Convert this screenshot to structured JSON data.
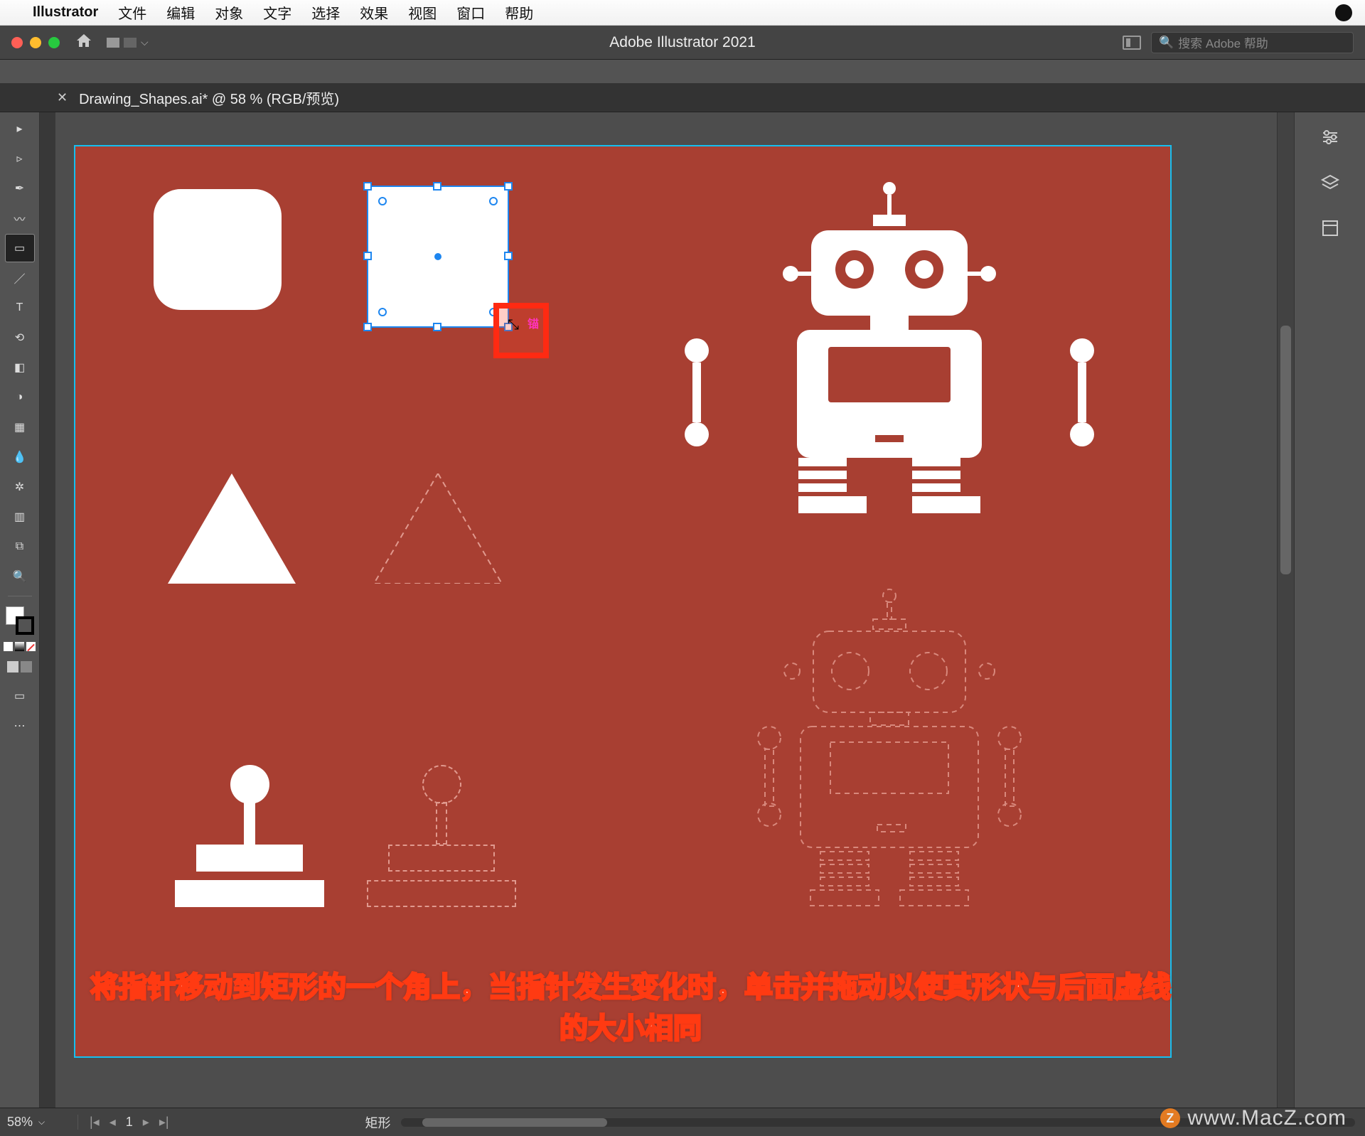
{
  "macos_menu": {
    "app": "Illustrator",
    "items": [
      "文件",
      "编辑",
      "对象",
      "文字",
      "选择",
      "效果",
      "视图",
      "窗口",
      "帮助"
    ]
  },
  "titlebar": {
    "app_title": "Adobe Illustrator 2021",
    "search_placeholder": "搜索 Adobe 帮助"
  },
  "document_tab": {
    "label": "Drawing_Shapes.ai* @ 58 % (RGB/预览)"
  },
  "tools": [
    {
      "name": "selection-tool",
      "glyph": "▸"
    },
    {
      "name": "direct-selection-tool",
      "glyph": "▹"
    },
    {
      "name": "pen-tool",
      "glyph": "✒"
    },
    {
      "name": "curvature-tool",
      "glyph": "〰"
    },
    {
      "name": "rectangle-tool",
      "glyph": "▭",
      "active": true
    },
    {
      "name": "paintbrush-tool",
      "glyph": "／"
    },
    {
      "name": "type-tool",
      "glyph": "T"
    },
    {
      "name": "rotate-tool",
      "glyph": "⟲"
    },
    {
      "name": "eraser-tool",
      "glyph": "◧"
    },
    {
      "name": "shape-builder-tool",
      "glyph": "◑"
    },
    {
      "name": "gradient-tool",
      "glyph": "▦"
    },
    {
      "name": "eyedropper-tool",
      "glyph": "💧"
    },
    {
      "name": "symbol-sprayer-tool",
      "glyph": "✲"
    },
    {
      "name": "graph-tool",
      "glyph": "▥"
    },
    {
      "name": "artboard-tool",
      "glyph": "⧉"
    },
    {
      "name": "zoom-tool",
      "glyph": "🔍"
    }
  ],
  "canvas": {
    "anchor_label": "锚"
  },
  "right_panels": [
    {
      "name": "properties-panel-icon",
      "glyph": "⚙"
    },
    {
      "name": "layers-panel-icon",
      "glyph": "◆"
    },
    {
      "name": "libraries-panel-icon",
      "glyph": "▢"
    }
  ],
  "instruction": {
    "line1": "将指针移动到矩形的一个角上，当指针发生变化时，单击并拖动以使其形状与后面虚线",
    "line2": "的大小相同"
  },
  "statusbar": {
    "zoom": "58%",
    "artboard_number": "1",
    "selection_type": "矩形"
  },
  "watermark": {
    "text": "www.MacZ.com",
    "badge": "Z"
  }
}
